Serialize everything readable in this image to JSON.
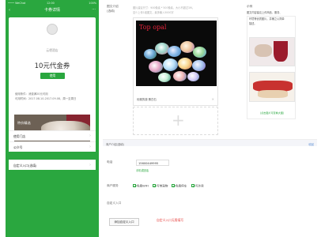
{
  "status_bar": {
    "left": "•••• WeChat",
    "time": "12:00",
    "battery": "100%"
  },
  "phone_nav": {
    "title": "卡券详情",
    "back": "‹",
    "more": "···"
  },
  "card": {
    "merchant": "云栖酒店",
    "title": "10元代金券",
    "use_button": "使用",
    "condition": "使用条件：消费满20元可用",
    "validity": "可用时间：2017.08.10-2017.09.08，周一至周日",
    "promo_title": "特价精选",
    "promo_subtitle": "更多优惠等你来"
  },
  "phone_cells": [
    {
      "label": "使用门店",
      "chev": "›"
    },
    {
      "label": "公众号",
      "chev": "›"
    },
    {
      "label": "自定义入口(选填)",
      "chev": "›"
    }
  ],
  "editor": {
    "image_text_label": "图文介绍",
    "image_text_optional": "(选填)",
    "image_hint_1": "图片建议尺寸：900像素 * 500像素，大小不超过1M。",
    "image_hint_2": "至少上传1组图文，最多输入5000字",
    "image_brand": "Top opal",
    "image_caption": "优雅的澳 蛋白石",
    "image_delete": "✕",
    "add_plus": "+",
    "preview_label": "示例",
    "preview_text_1": "图文内容建议上传商品、服务、",
    "preview_text_2": "环境等优质图片，并辅之以简单",
    "preview_text_3": "描述。",
    "preview_caption": "(点击图片可查看大图)",
    "merchant_intro_label": "商户介绍(选填)",
    "merchant_intro_link": "收起",
    "phone_label": "电话",
    "phone_value": "15600449995",
    "phone_tip": "手机或固话",
    "service_label": "商户服务",
    "services": [
      "免费WIFI",
      "可带宠物",
      "免费停车",
      "可外卖"
    ],
    "custom_entry_label": "自定义入口",
    "add_entry_button": "添加自定义入口",
    "warn_text": "自定义入口无需填写"
  },
  "colors": {
    "wechat_green": "#2aa73f",
    "link_blue": "#5d8fd5",
    "warn_red": "#e64340",
    "brand_red": "#e8243c"
  }
}
